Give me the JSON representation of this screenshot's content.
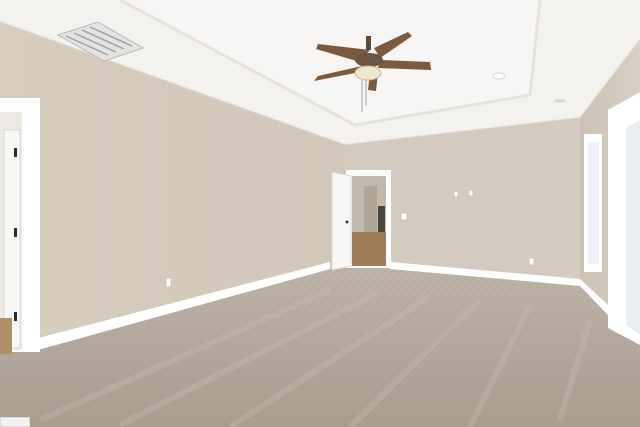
{
  "scene": {
    "description_type": "photo",
    "colors": {
      "ceiling": "#f4f3f1",
      "tray_ceiling": "#f7f6f4",
      "wall_left": "#d8cfc3",
      "wall_back": "#d3cbbf",
      "wall_right": "#cfc7ba",
      "carpet": "#b3a89c",
      "baseboard": "#ffffff",
      "trim": "#ffffff",
      "door": "#f5f5f3",
      "fan_blade": "#7b5a3f",
      "fan_metal": "#5a4a3a",
      "fan_light": "#efe6cf",
      "hallway": "#bfb6aa",
      "hall_floor": "#9c7c57",
      "window_glass": "#eef2f5",
      "vent": "#dcdcdc"
    },
    "icons": [
      "ceiling-fan-icon",
      "air-vent-icon",
      "outlet-icon",
      "light-switch-icon",
      "door-hinge-icon"
    ]
  }
}
